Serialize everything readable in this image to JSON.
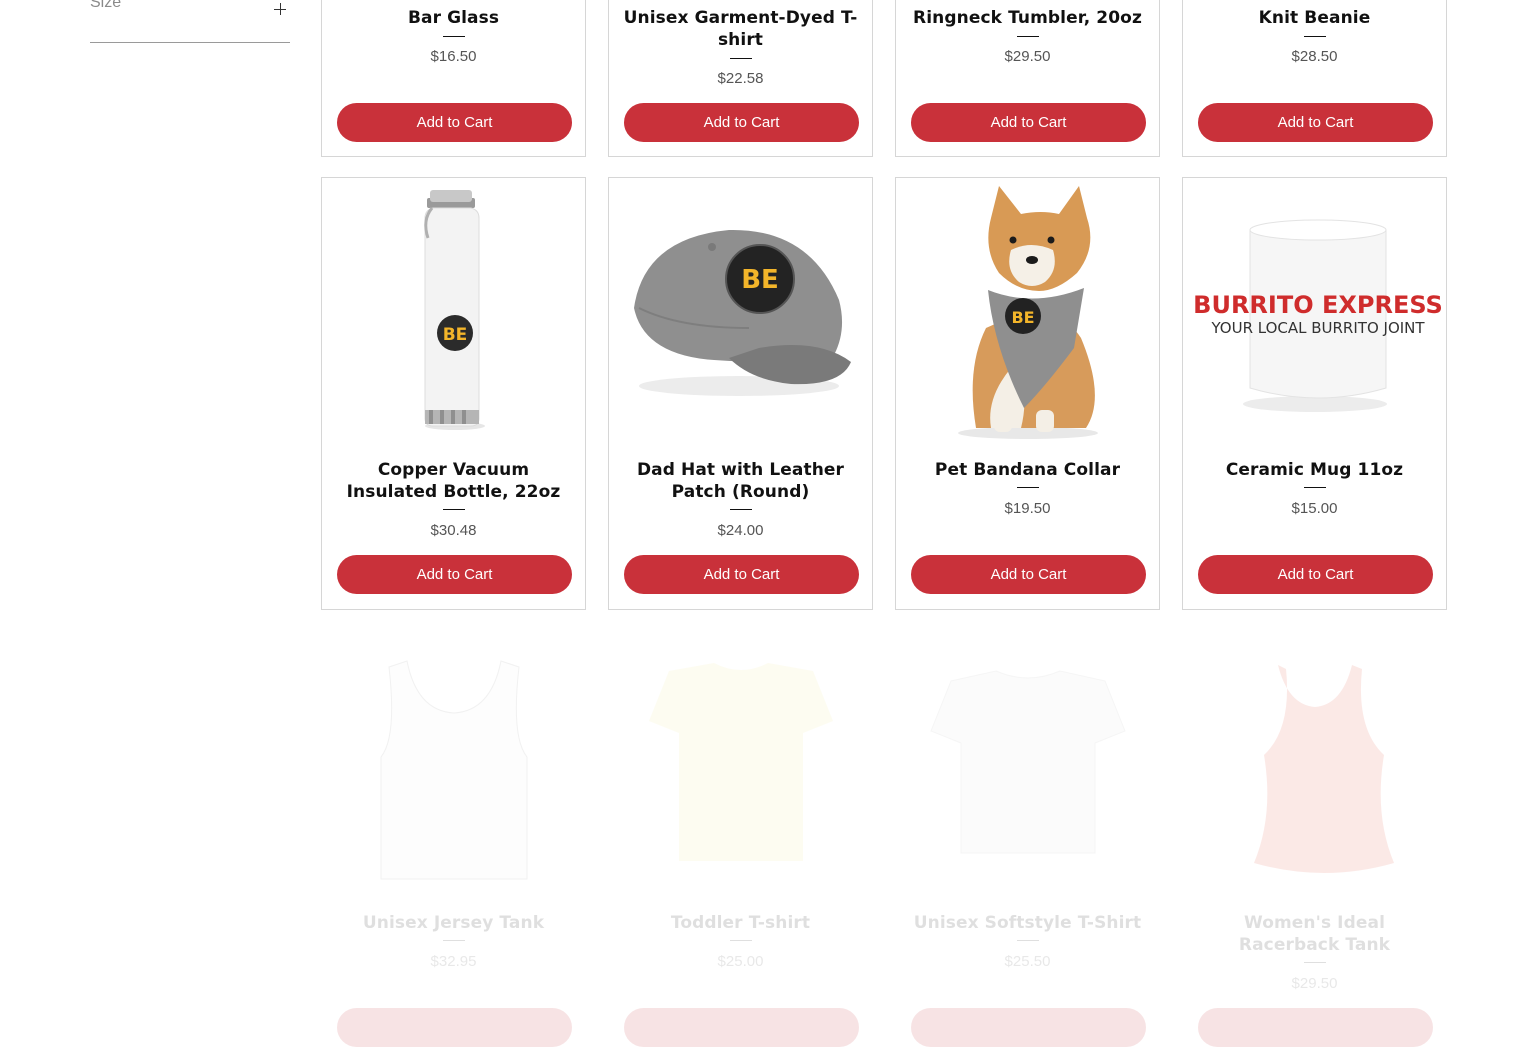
{
  "filter": {
    "label": "Size",
    "icon": "plus-icon"
  },
  "colors": {
    "button": "#c9313a",
    "border": "#d6d6d6",
    "price": "#555555"
  },
  "products_row1": [
    {
      "title": "Bar Glass",
      "price": "$16.50",
      "button": "Add to Cart"
    },
    {
      "title": "Unisex Garment-Dyed T-shirt",
      "price": "$22.58",
      "button": "Add to Cart"
    },
    {
      "title": "Ringneck Tumbler, 20oz",
      "price": "$29.50",
      "button": "Add to Cart"
    },
    {
      "title": "Knit Beanie",
      "price": "$28.50",
      "button": "Add to Cart"
    }
  ],
  "products_row2": [
    {
      "title": "Copper Vacuum Insulated Bottle, 22oz",
      "price": "$30.48",
      "button": "Add to Cart",
      "image": "white-bottle-be-logo"
    },
    {
      "title": "Dad Hat with Leather Patch (Round)",
      "price": "$24.00",
      "button": "Add to Cart",
      "image": "grey-cap-be-patch"
    },
    {
      "title": "Pet Bandana Collar",
      "price": "$19.50",
      "button": "Add to Cart",
      "image": "dog-grey-bandana"
    },
    {
      "title": "Ceramic Mug 11oz",
      "price": "$15.00",
      "button": "Add to Cart",
      "image": "white-mug-burrito-express",
      "mug_text_1": "BURRITO EXPRESS",
      "mug_text_2": "YOUR LOCAL BURRITO JOINT"
    }
  ],
  "products_row3": [
    {
      "title": "Unisex Jersey Tank",
      "price": "$32.95",
      "image": "white-tank"
    },
    {
      "title": "Toddler T-shirt",
      "price": "$25.00",
      "image": "yellow-toddler-tee"
    },
    {
      "title": "Unisex Softstyle T-Shirt",
      "price": "$25.50",
      "image": "white-tee"
    },
    {
      "title": "Women's Ideal Racerback Tank",
      "price": "$29.50",
      "image": "red-racerback-tank"
    }
  ],
  "logo": {
    "text": "BE"
  }
}
